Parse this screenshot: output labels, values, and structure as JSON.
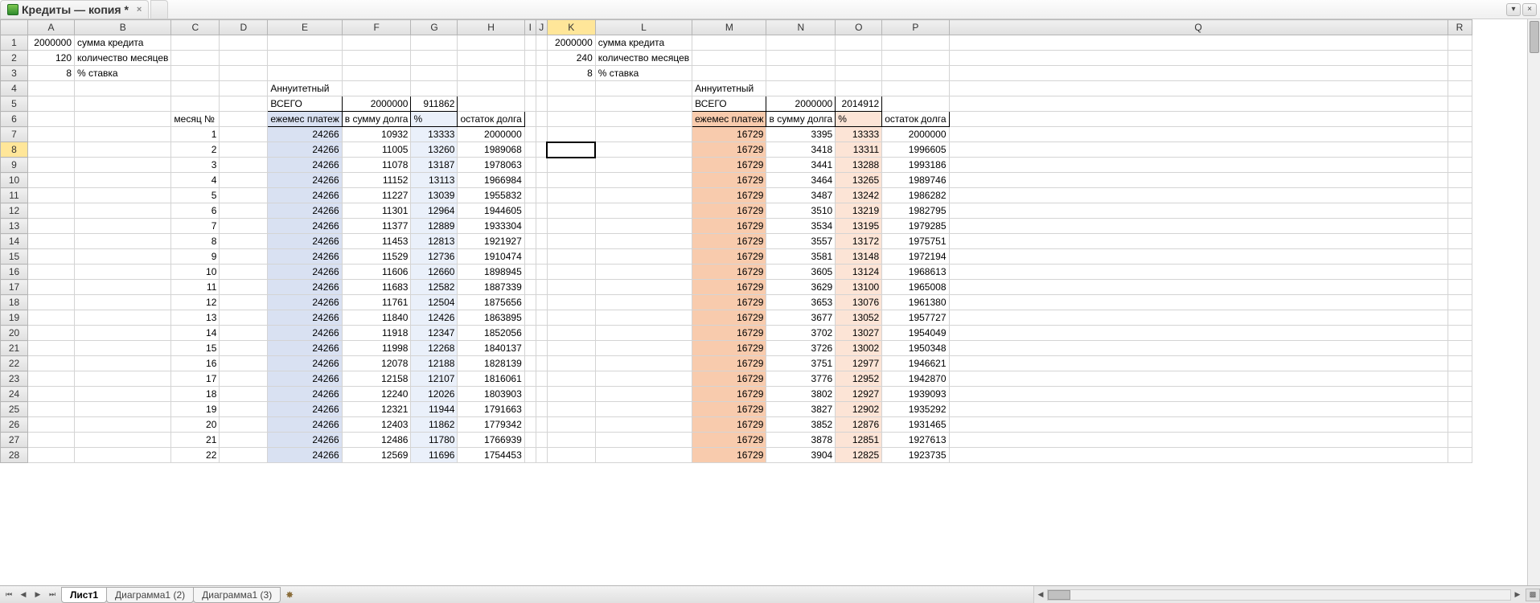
{
  "doc_tabs": {
    "active_icon": "spreadsheet-icon",
    "active_title": "Кредиты — копия *",
    "close_glyph": "×"
  },
  "top_right": {
    "dropdown_glyph": "▾",
    "close_glyph": "×"
  },
  "columns": [
    "A",
    "B",
    "C",
    "D",
    "E",
    "F",
    "G",
    "H",
    "I",
    "J",
    "K",
    "L",
    "M",
    "N",
    "O",
    "P",
    "Q",
    "R"
  ],
  "active_col": "K",
  "active_row": 8,
  "cursor": "K8",
  "rows": [
    {
      "n": 1,
      "A": "2000000",
      "B": "сумма кредита",
      "K": "2000000",
      "L": "сумма кредита"
    },
    {
      "n": 2,
      "A": "120",
      "B": "количество месяцев",
      "K": "240",
      "L": "количество месяцев"
    },
    {
      "n": 3,
      "A": "8",
      "B": "% ставка",
      "K": "8",
      "L": "% ставка"
    },
    {
      "n": 4,
      "E": "Аннуитетный",
      "M": "Аннуитетный"
    },
    {
      "n": 5,
      "E": "ВСЕГО",
      "F": "2000000",
      "G": "911862",
      "M": "ВСЕГО",
      "N": "2000000",
      "O": "2014912"
    },
    {
      "n": 6,
      "C": "месяц №",
      "E": "ежемес платеж",
      "F": "в сумму долга",
      "G": "%",
      "H": "остаток долга",
      "M": "ежемес платеж",
      "N": "в сумму долга",
      "O": "%",
      "P": "остаток долга"
    },
    {
      "n": 7,
      "C": "1",
      "E": "24266",
      "F": "10932",
      "G": "13333",
      "H": "2000000",
      "M": "16729",
      "N": "3395",
      "O": "13333",
      "P": "2000000"
    },
    {
      "n": 8,
      "C": "2",
      "E": "24266",
      "F": "11005",
      "G": "13260",
      "H": "1989068",
      "M": "16729",
      "N": "3418",
      "O": "13311",
      "P": "1996605"
    },
    {
      "n": 9,
      "C": "3",
      "E": "24266",
      "F": "11078",
      "G": "13187",
      "H": "1978063",
      "M": "16729",
      "N": "3441",
      "O": "13288",
      "P": "1993186"
    },
    {
      "n": 10,
      "C": "4",
      "E": "24266",
      "F": "11152",
      "G": "13113",
      "H": "1966984",
      "M": "16729",
      "N": "3464",
      "O": "13265",
      "P": "1989746"
    },
    {
      "n": 11,
      "C": "5",
      "E": "24266",
      "F": "11227",
      "G": "13039",
      "H": "1955832",
      "M": "16729",
      "N": "3487",
      "O": "13242",
      "P": "1986282"
    },
    {
      "n": 12,
      "C": "6",
      "E": "24266",
      "F": "11301",
      "G": "12964",
      "H": "1944605",
      "M": "16729",
      "N": "3510",
      "O": "13219",
      "P": "1982795"
    },
    {
      "n": 13,
      "C": "7",
      "E": "24266",
      "F": "11377",
      "G": "12889",
      "H": "1933304",
      "M": "16729",
      "N": "3534",
      "O": "13195",
      "P": "1979285"
    },
    {
      "n": 14,
      "C": "8",
      "E": "24266",
      "F": "11453",
      "G": "12813",
      "H": "1921927",
      "M": "16729",
      "N": "3557",
      "O": "13172",
      "P": "1975751"
    },
    {
      "n": 15,
      "C": "9",
      "E": "24266",
      "F": "11529",
      "G": "12736",
      "H": "1910474",
      "M": "16729",
      "N": "3581",
      "O": "13148",
      "P": "1972194"
    },
    {
      "n": 16,
      "C": "10",
      "E": "24266",
      "F": "11606",
      "G": "12660",
      "H": "1898945",
      "M": "16729",
      "N": "3605",
      "O": "13124",
      "P": "1968613"
    },
    {
      "n": 17,
      "C": "11",
      "E": "24266",
      "F": "11683",
      "G": "12582",
      "H": "1887339",
      "M": "16729",
      "N": "3629",
      "O": "13100",
      "P": "1965008"
    },
    {
      "n": 18,
      "C": "12",
      "E": "24266",
      "F": "11761",
      "G": "12504",
      "H": "1875656",
      "M": "16729",
      "N": "3653",
      "O": "13076",
      "P": "1961380"
    },
    {
      "n": 19,
      "C": "13",
      "E": "24266",
      "F": "11840",
      "G": "12426",
      "H": "1863895",
      "M": "16729",
      "N": "3677",
      "O": "13052",
      "P": "1957727"
    },
    {
      "n": 20,
      "C": "14",
      "E": "24266",
      "F": "11918",
      "G": "12347",
      "H": "1852056",
      "M": "16729",
      "N": "3702",
      "O": "13027",
      "P": "1954049"
    },
    {
      "n": 21,
      "C": "15",
      "E": "24266",
      "F": "11998",
      "G": "12268",
      "H": "1840137",
      "M": "16729",
      "N": "3726",
      "O": "13002",
      "P": "1950348"
    },
    {
      "n": 22,
      "C": "16",
      "E": "24266",
      "F": "12078",
      "G": "12188",
      "H": "1828139",
      "M": "16729",
      "N": "3751",
      "O": "12977",
      "P": "1946621"
    },
    {
      "n": 23,
      "C": "17",
      "E": "24266",
      "F": "12158",
      "G": "12107",
      "H": "1816061",
      "M": "16729",
      "N": "3776",
      "O": "12952",
      "P": "1942870"
    },
    {
      "n": 24,
      "C": "18",
      "E": "24266",
      "F": "12240",
      "G": "12026",
      "H": "1803903",
      "M": "16729",
      "N": "3802",
      "O": "12927",
      "P": "1939093"
    },
    {
      "n": 25,
      "C": "19",
      "E": "24266",
      "F": "12321",
      "G": "11944",
      "H": "1791663",
      "M": "16729",
      "N": "3827",
      "O": "12902",
      "P": "1935292"
    },
    {
      "n": 26,
      "C": "20",
      "E": "24266",
      "F": "12403",
      "G": "11862",
      "H": "1779342",
      "M": "16729",
      "N": "3852",
      "O": "12876",
      "P": "1931465"
    },
    {
      "n": 27,
      "C": "21",
      "E": "24266",
      "F": "12486",
      "G": "11780",
      "H": "1766939",
      "M": "16729",
      "N": "3878",
      "O": "12851",
      "P": "1927613"
    },
    {
      "n": 28,
      "C": "22",
      "E": "24266",
      "F": "12569",
      "G": "11696",
      "H": "1754453",
      "M": "16729",
      "N": "3904",
      "O": "12825",
      "P": "1923735"
    }
  ],
  "sheet_tabs": {
    "nav_first": "⏮",
    "nav_prev": "◀",
    "nav_next": "▶",
    "nav_last": "⏭",
    "tabs": [
      {
        "label": "Лист1",
        "active": true
      },
      {
        "label": "Диаграмма1 (2)",
        "active": false
      },
      {
        "label": "Диаграмма1 (3)",
        "active": false
      }
    ],
    "add_glyph": "✸"
  }
}
